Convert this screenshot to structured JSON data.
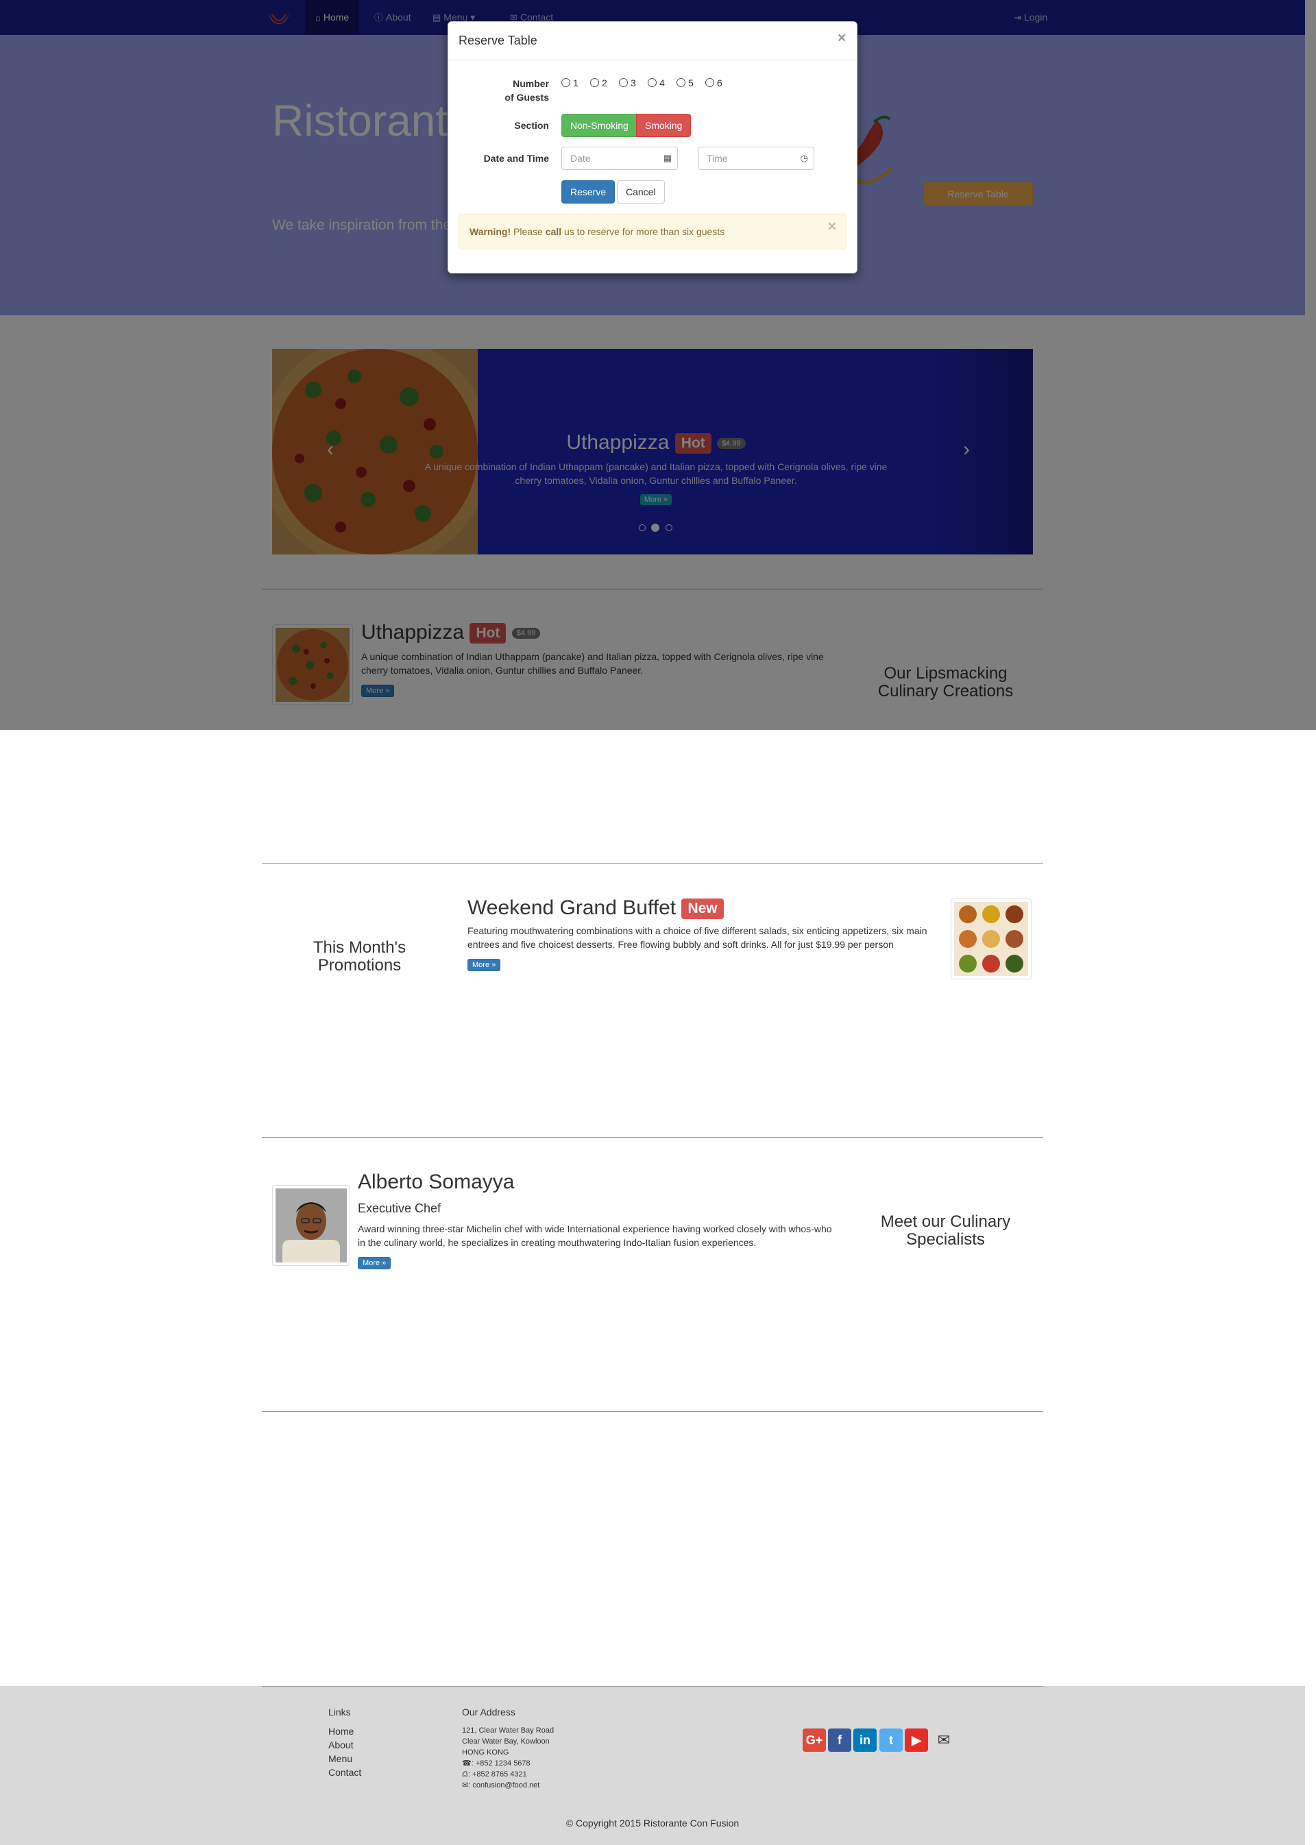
{
  "nav": {
    "home": "Home",
    "about": "About",
    "menu": "Menu",
    "contact": "Contact",
    "login": "Login"
  },
  "jumbotron": {
    "title": "Ristorante",
    "text": "We take inspiration from the experience. Our lipsmacking",
    "reserve_button": "Reserve Table"
  },
  "carousel": {
    "title": "Uthappizza",
    "label": "Hot",
    "price": "$4.99",
    "description": "A unique combination of Indian Uthappam (pancake) and Italian pizza, topped with Cerignola olives, ripe vine cherry tomatoes, Vidalia onion, Guntur chillies and Buffalo Paneer.",
    "more": "More »",
    "active_slide": 2,
    "slide_count": 3
  },
  "dish": {
    "title": "Uthappizza",
    "label": "Hot",
    "price": "$4.99",
    "description": "A unique combination of Indian Uthappam (pancake) and Italian pizza, topped with Cerignola olives, ripe vine cherry tomatoes, Vidalia onion, Guntur chillies and Buffalo Paneer.",
    "more": "More »",
    "heading": "Our Lipsmacking Culinary Creations"
  },
  "promotion": {
    "heading": "This Month's Promotions",
    "title": "Weekend Grand Buffet",
    "label": "New",
    "description": "Featuring mouthwatering combinations with a choice of five different salads, six enticing appetizers, six main entrees and five choicest desserts. Free flowing bubbly and soft drinks. All for just $19.99 per person",
    "more": "More »"
  },
  "chef": {
    "name": "Alberto Somayya",
    "role": "Executive Chef",
    "description": "Award winning three-star Michelin chef with wide International experience having worked closely with whos-who in the culinary world, he specializes in creating mouthwatering Indo-Italian fusion experiences.",
    "more": "More »",
    "heading": "Meet our Culinary Specialists"
  },
  "footer": {
    "links_heading": "Links",
    "links": [
      "Home",
      "About",
      "Menu",
      "Contact"
    ],
    "address_heading": "Our Address",
    "address_lines": [
      "121, Clear Water Bay Road",
      "Clear Water Bay, Kowloon",
      "HONG KONG"
    ],
    "phone": "+852 1234 5678",
    "fax": "+852 8765 4321",
    "email": "confusion@food.net",
    "social": [
      "G+",
      "f",
      "in",
      "t",
      "▶",
      "✉"
    ],
    "copyright": "© Copyright 2015 Ristorante Con Fusion"
  },
  "modal": {
    "title": "Reserve Table",
    "close": "×",
    "guests_label_1": "Number",
    "guests_label_2": "of Guests",
    "guest_options": [
      "1",
      "2",
      "3",
      "4",
      "5",
      "6"
    ],
    "section_label": "Section",
    "section_non_smoking": "Non-Smoking",
    "section_smoking": "Smoking",
    "datetime_label": "Date and Time",
    "date_placeholder": "Date",
    "time_placeholder": "Time",
    "reserve_button": "Reserve",
    "cancel_button": "Cancel",
    "alert_strong": "Warning!",
    "alert_pre": "Please",
    "alert_call": "call",
    "alert_post": "us to reserve for more than six guests"
  },
  "colors": {
    "navbar": "#1a2196",
    "jumbotron": "#9fa6f3",
    "reserve_button": "#f0ad4e",
    "label_hot": "#d9534f",
    "primary": "#337ab7",
    "success": "#5cb85c",
    "warning_bg": "#fcf8e3"
  }
}
